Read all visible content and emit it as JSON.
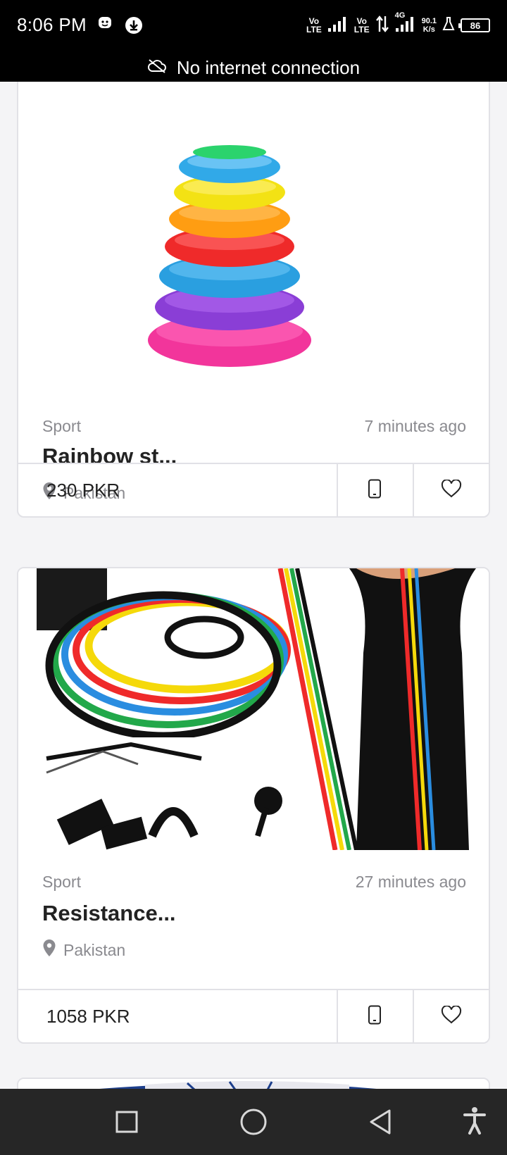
{
  "status_bar": {
    "time": "8:06 PM",
    "sim1_label_top": "Vo",
    "sim1_label_bottom": "LTE",
    "sim2_label_top": "Vo",
    "sim2_label_bottom": "LTE",
    "network_type": "4G",
    "speed_value": "90.1",
    "speed_unit": "K/s",
    "battery_level": "86"
  },
  "offline_banner": {
    "text": "No internet connection"
  },
  "listings": [
    {
      "category": "Sport",
      "posted": "7 minutes ago",
      "title": "Rainbow st...",
      "location": "Pakistan",
      "price": "230 PKR"
    },
    {
      "category": "Sport",
      "posted": "27 minutes ago",
      "title": "Resistance...",
      "location": "Pakistan",
      "price": "1058 PKR"
    }
  ],
  "icons": {
    "phone": "mobile-phone-icon",
    "favorite": "heart-outline-icon",
    "location": "map-pin-icon",
    "offline": "cloud-off-icon"
  },
  "colors": {
    "status_bar_bg": "#000000",
    "nav_bar_bg": "#262626",
    "card_border": "#e1e1e6",
    "muted_text": "#8a8a8f",
    "page_bg": "#f4f4f6"
  }
}
